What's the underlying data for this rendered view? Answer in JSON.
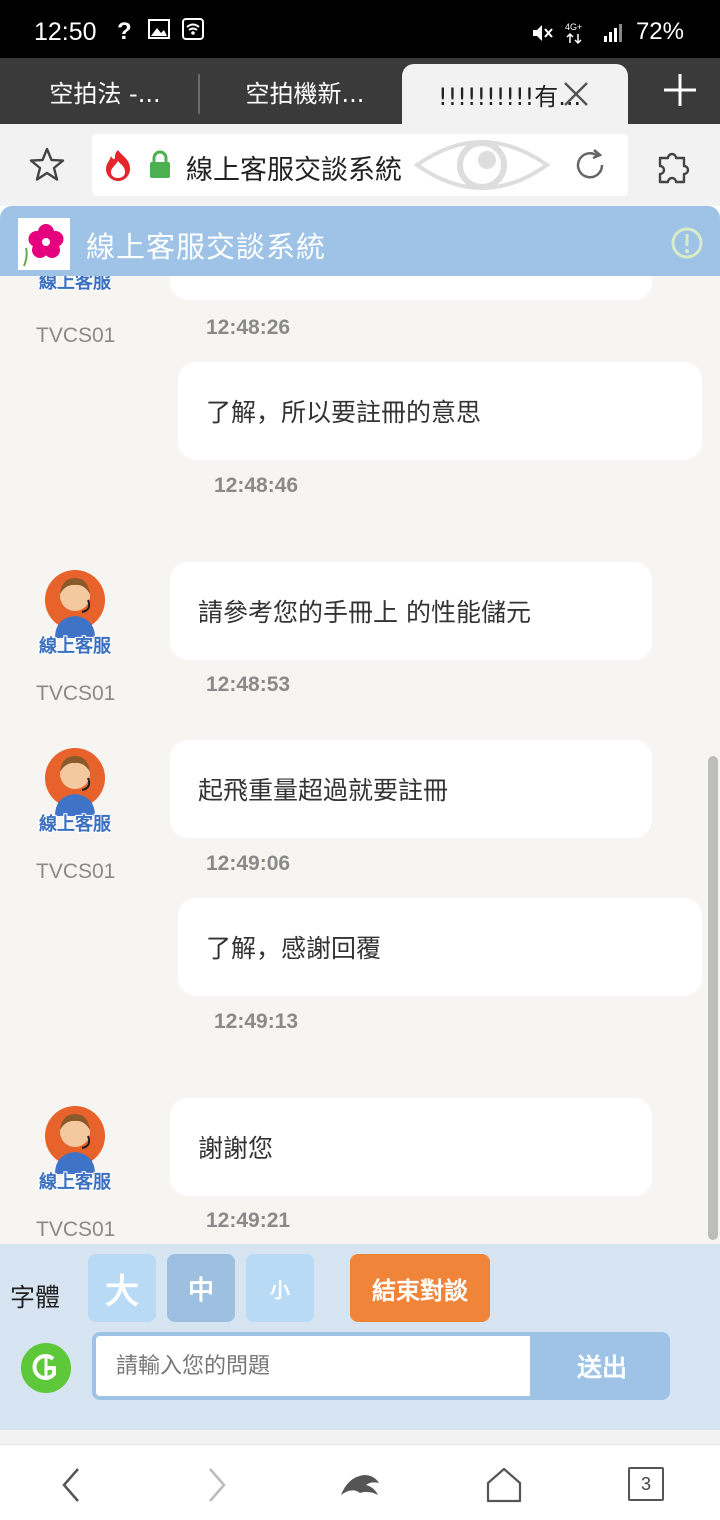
{
  "status_bar": {
    "time": "12:50",
    "battery": "72%",
    "network": "4G+"
  },
  "tabs": [
    {
      "label": "空拍法 -..."
    },
    {
      "label": "空拍機新..."
    },
    {
      "label": "!!!!!!!!!!有..."
    }
  ],
  "address_bar": {
    "url_title": "線上客服交談系統"
  },
  "chat_header": {
    "title": "線上客服交談系統"
  },
  "messages": [
    {
      "from": "agent",
      "agent_id": "TVCS01",
      "text": "",
      "time": "12:48:26",
      "avatar_label": "線上客服"
    },
    {
      "from": "user",
      "text": "了解，所以要註冊的意思",
      "time": "12:48:46"
    },
    {
      "from": "agent",
      "agent_id": "TVCS01",
      "text": "請參考您的手冊上 的性能儲元",
      "time": "12:48:53",
      "avatar_label": "線上客服"
    },
    {
      "from": "agent",
      "agent_id": "TVCS01",
      "text": "起飛重量超過就要註冊",
      "time": "12:49:06",
      "avatar_label": "線上客服"
    },
    {
      "from": "user",
      "text": "了解，感謝回覆",
      "time": "12:49:13"
    },
    {
      "from": "agent",
      "agent_id": "TVCS01",
      "text": "謝謝您",
      "time": "12:49:21",
      "avatar_label": "線上客服"
    }
  ],
  "controls": {
    "font_label": "字體",
    "font_large": "大",
    "font_medium": "中",
    "font_small": "小",
    "end_chat": "結束對談",
    "input_placeholder": "請輸入您的問題",
    "send": "送出"
  },
  "nav": {
    "tab_count": "3"
  },
  "colors": {
    "header_blue": "#9ec3e6",
    "end_orange": "#f0853a",
    "chat_bg": "#f6f5f1",
    "controls_bg": "#d7e4f1"
  }
}
